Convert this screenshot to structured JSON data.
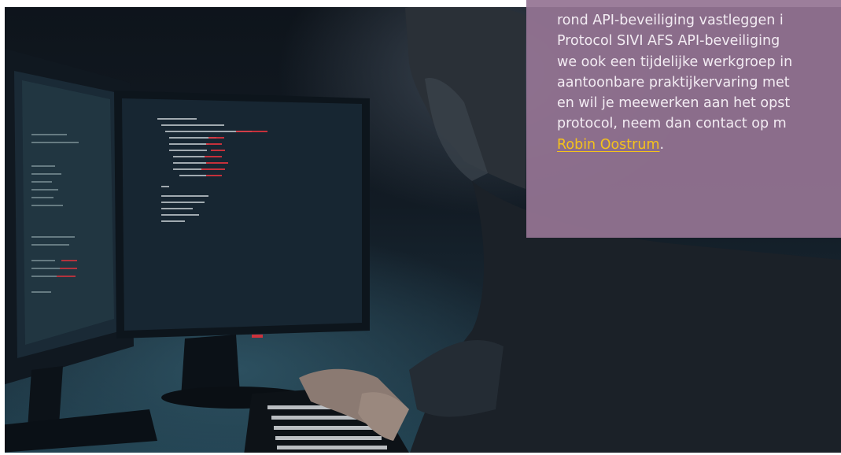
{
  "hero": {
    "image": "developer-at-monitors-photo",
    "colors": {
      "background_dark": "#0e141b",
      "screen_glow": "#2c5060",
      "code_red": "#d8333d",
      "code_white": "#e8e8e8"
    }
  },
  "info_box": {
    "background": "#947493",
    "text_color": "#f3ecf3",
    "link_color": "#f5c21b",
    "lines": [
      "rond API-beveiliging vastleggen i",
      "Protocol SIVI AFS API-beveiliging",
      "we ook een tijdelijke werkgroep in",
      "aantoonbare praktijkervaring met",
      "en wil je meewerken aan het opst",
      "protocol, neem dan contact op m"
    ],
    "contact_link": "Robin Oostrum",
    "after_link": "."
  }
}
